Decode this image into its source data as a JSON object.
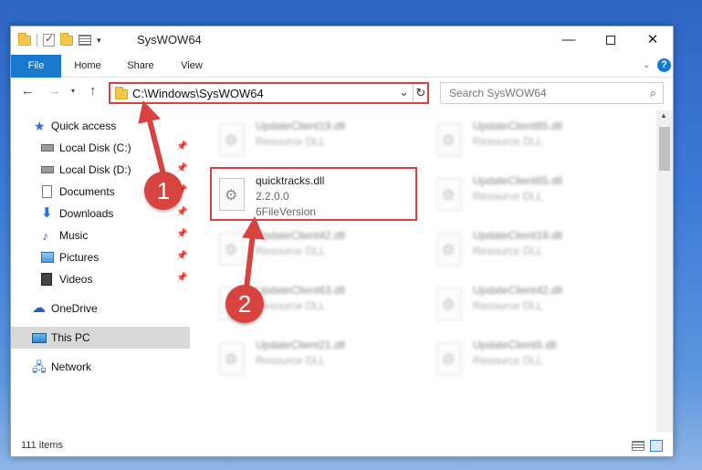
{
  "window": {
    "title": "SysWOW64",
    "controls": {
      "minimize": "—",
      "maximize": "",
      "close": "✕"
    }
  },
  "ribbon": {
    "tabs": [
      "File",
      "Home",
      "Share",
      "View"
    ],
    "help": "?"
  },
  "address": {
    "path": "C:\\Windows\\SysWOW64",
    "search_placeholder": "Search SysWOW64"
  },
  "nav_pane": {
    "items": [
      {
        "label": "Quick access",
        "icon": "star-icon"
      },
      {
        "label": "Local Disk (C:)",
        "icon": "disk-icon",
        "pinned": true
      },
      {
        "label": "Local Disk (D:)",
        "icon": "disk-icon",
        "pinned": true
      },
      {
        "label": "Documents",
        "icon": "documents-icon",
        "pinned": true
      },
      {
        "label": "Downloads",
        "icon": "downloads-icon",
        "pinned": true
      },
      {
        "label": "Music",
        "icon": "music-icon",
        "pinned": true
      },
      {
        "label": "Pictures",
        "icon": "pictures-icon",
        "pinned": true
      },
      {
        "label": "Videos",
        "icon": "videos-icon",
        "pinned": true
      },
      {
        "label": "OneDrive",
        "icon": "onedrive-icon"
      },
      {
        "label": "This PC",
        "icon": "this-pc-icon",
        "selected": true
      },
      {
        "label": "Network",
        "icon": "network-icon"
      }
    ]
  },
  "files": {
    "highlighted": {
      "name": "quicktracks.dll",
      "version": "2.2.0.0",
      "description": "6FileVersion"
    },
    "others": [
      {
        "name": "UpdateClient19.dll",
        "type": "Resource DLL"
      },
      {
        "name": "UpdateClient65.dll",
        "type": "Resource DLL"
      },
      {
        "name": "UpdateClient65.dll",
        "type": "Resource DLL"
      },
      {
        "name": "UpdateClient42.dll",
        "type": "Resource DLL"
      },
      {
        "name": "UpdateClient19.dll",
        "type": "Resource DLL"
      },
      {
        "name": "UpdateClient63.dll",
        "type": "Resource DLL"
      },
      {
        "name": "UpdateClient42.dll",
        "type": "Resource DLL"
      },
      {
        "name": "UpdateClient21.dll",
        "type": "Resource DLL"
      },
      {
        "name": "UpdateClient5.dll",
        "type": "Resource DLL"
      }
    ]
  },
  "status": {
    "item_count": "111 items"
  },
  "callouts": [
    "1",
    "2"
  ],
  "colors": {
    "accent": "#1979ca",
    "callout": "#d8423f",
    "highlight": "#d9403f"
  }
}
